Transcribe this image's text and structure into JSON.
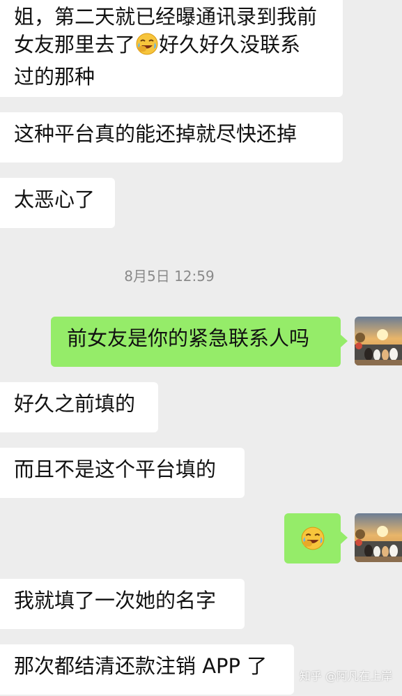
{
  "messages": [
    {
      "side": "left",
      "lines": [
        "姐，第二天就已经曝通讯录到我前",
        "女友那里去了",
        "好久好久没联系",
        "过的那种"
      ],
      "emoji": "facepalm-laugh-emoji"
    },
    {
      "side": "left",
      "text": "这种平台真的能还掉就尽快还掉"
    },
    {
      "side": "left",
      "text": "太恶心了"
    },
    {
      "side": "right",
      "text": "前女友是你的紧急联系人吗"
    },
    {
      "side": "left",
      "text": "好久之前填的"
    },
    {
      "side": "left",
      "text": "而且不是这个平台填的"
    },
    {
      "side": "right",
      "emoji": "facepalm-laugh-emoji"
    },
    {
      "side": "left",
      "text": "我就填了一次她的名字"
    },
    {
      "side": "left",
      "text": "那次都结清还款注销 APP 了"
    }
  ],
  "timestamp": "8月5日 12:59",
  "watermark": "知乎 @阿凡在上岸",
  "colors": {
    "background": "#ededed",
    "incoming_bubble": "#ffffff",
    "outgoing_bubble": "#95ec69",
    "timestamp": "#8a8a8a"
  }
}
